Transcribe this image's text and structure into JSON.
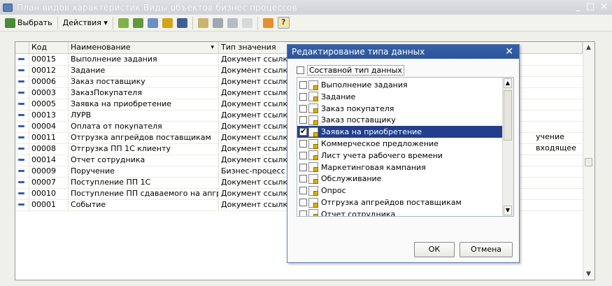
{
  "window": {
    "title": "План видов характеристик Виды объектов бизнес процессов",
    "controls": [
      "_",
      "□",
      "×"
    ]
  },
  "toolbar": {
    "select_label": "Выбрать",
    "actions_label": "Действия ▾",
    "help_label": "?"
  },
  "grid": {
    "columns": [
      "Код",
      "Наименование",
      "Тип значения"
    ],
    "sort_indicator": "▾",
    "rows": [
      {
        "code": "00015",
        "name": "Выполнение задания",
        "type": "Документ ссылка"
      },
      {
        "code": "00012",
        "name": "Задание",
        "type": "Документ ссылка"
      },
      {
        "code": "00006",
        "name": "Заказ поставщику",
        "type": "Документ ссылка"
      },
      {
        "code": "00003",
        "name": "ЗаказПокупателя",
        "type": "Документ ссылка"
      },
      {
        "code": "00005",
        "name": "Заявка на приобретение",
        "type": "Документ ссылка"
      },
      {
        "code": "00013",
        "name": "ЛУРВ",
        "type": "Документ ссылка"
      },
      {
        "code": "00004",
        "name": "Оплата от покупателя",
        "type": "Документ ссылка"
      },
      {
        "code": "00011",
        "name": "Отгрузка апгрейдов поставщикам",
        "type": "Документ ссылка"
      },
      {
        "code": "00008",
        "name": "Отгрузка ПП 1С клиенту",
        "type": "Документ ссылка"
      },
      {
        "code": "00014",
        "name": "Отчет сотрудника",
        "type": "Документ ссылка"
      },
      {
        "code": "00009",
        "name": "Поручение",
        "type": "Бизнес-процесс с"
      },
      {
        "code": "00007",
        "name": "Поступление ПП 1С",
        "type": "Документ ссылка"
      },
      {
        "code": "00010",
        "name": "Поступление ПП сдаваемого на апгр...",
        "type": "Документ ссылка"
      },
      {
        "code": "00001",
        "name": "Событие",
        "type": "Документ ссылка"
      }
    ],
    "right_fragment": "учение входящее",
    "ellipsis": "..."
  },
  "dialog": {
    "title": "Редактирование типа данных",
    "close": "✕",
    "composite_label": "Составной тип данных",
    "items": [
      {
        "label": "Выполнение задания",
        "checked": false
      },
      {
        "label": "Задание",
        "checked": false
      },
      {
        "label": "Заказ покупателя",
        "checked": false
      },
      {
        "label": "Заказ поставщику",
        "checked": false
      },
      {
        "label": "Заявка на приобретение",
        "checked": true
      },
      {
        "label": "Коммерческое предложение",
        "checked": false
      },
      {
        "label": "Лист учета рабочего времени",
        "checked": false
      },
      {
        "label": "Маркетинговая кампания",
        "checked": false
      },
      {
        "label": "Обслуживание",
        "checked": false
      },
      {
        "label": "Опрос",
        "checked": false
      },
      {
        "label": "Отгрузка апгрейдов поставщикам",
        "checked": false
      },
      {
        "label": "Отчет сотрудника",
        "checked": false
      }
    ],
    "ok_label": "ОК",
    "cancel_label": "Отмена"
  },
  "colors": {
    "dialog_title_bg": "#2d5599",
    "selection_bg": "#223e8c",
    "row_marker": "#2f5faa"
  }
}
